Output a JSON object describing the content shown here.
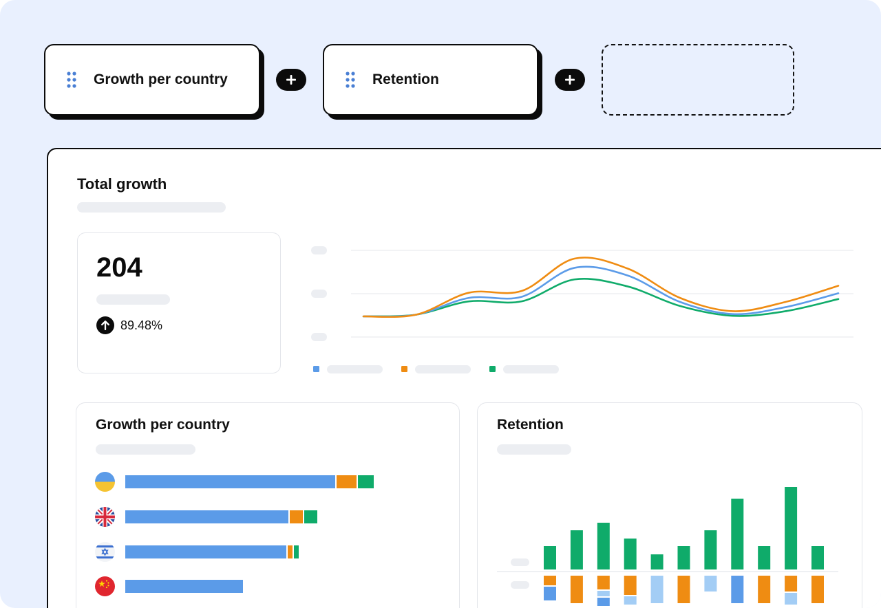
{
  "widgets": {
    "chips": [
      {
        "label": "Growth per country"
      },
      {
        "label": "Retention"
      }
    ]
  },
  "colors": {
    "blue": "#5b9be8",
    "orange": "#ef8c12",
    "green": "#0fab6a",
    "light_blue": "#a3cdf5",
    "dark": "#0b0b0b"
  },
  "dashboard": {
    "title": "Total growth",
    "stat": {
      "value": "204",
      "change": "89.48%",
      "trend_icon": "arrow-up-icon"
    },
    "growth_per_country": {
      "title": "Growth per country",
      "rows": [
        {
          "flag": "ukraine-flag-icon",
          "segments": [
            {
              "color": "blue",
              "value": 305
            },
            {
              "color": "orange",
              "value": 31
            },
            {
              "color": "green",
              "value": 25
            }
          ]
        },
        {
          "flag": "uk-flag-icon",
          "segments": [
            {
              "color": "blue",
              "value": 237
            },
            {
              "color": "orange",
              "value": 21
            },
            {
              "color": "green",
              "value": 21
            }
          ]
        },
        {
          "flag": "israel-flag-icon",
          "segments": [
            {
              "color": "blue",
              "value": 234
            },
            {
              "color": "orange",
              "value": 9
            },
            {
              "color": "green",
              "value": 9
            }
          ]
        },
        {
          "flag": "china-flag-icon",
          "segments": [
            {
              "color": "blue",
              "value": 171
            }
          ]
        }
      ]
    },
    "retention": {
      "title": "Retention"
    }
  },
  "chart_data": [
    {
      "type": "line",
      "title": "",
      "legend": "bottom-left",
      "grid": true,
      "x": [
        0,
        1,
        2,
        3,
        4,
        5,
        6,
        7,
        8,
        9
      ],
      "series": [
        {
          "color": "blue",
          "values": [
            0.0,
            0.3,
            3.2,
            3.4,
            8.4,
            7.1,
            2.5,
            0.4,
            1.6,
            4.0
          ]
        },
        {
          "color": "orange",
          "values": [
            0.0,
            0.3,
            4.1,
            4.4,
            10.0,
            8.3,
            3.2,
            0.9,
            2.5,
            5.3
          ]
        },
        {
          "color": "green",
          "values": [
            0.0,
            0.3,
            2.6,
            2.6,
            6.4,
            5.2,
            1.8,
            0.1,
            0.9,
            3.0
          ]
        }
      ],
      "ylim": [
        0,
        11
      ]
    },
    {
      "type": "bar",
      "title": "",
      "grid": true,
      "categories": [
        "1",
        "2",
        "3",
        "4",
        "5",
        "6",
        "7",
        "8",
        "9",
        "10",
        "11"
      ],
      "series": [
        {
          "color": "green",
          "direction": "up",
          "values": [
            34,
            57,
            68,
            45,
            22,
            34,
            57,
            103,
            34,
            120,
            34
          ]
        }
      ],
      "down_stacks": [
        [
          {
            "color": "orange",
            "value": 14
          },
          {
            "color": "blue",
            "value": 20
          }
        ],
        [
          {
            "color": "orange",
            "value": 40
          }
        ],
        [
          {
            "color": "orange",
            "value": 20
          },
          {
            "color": "light_blue",
            "value": 8
          },
          {
            "color": "blue",
            "value": 12
          }
        ],
        [
          {
            "color": "orange",
            "value": 28
          },
          {
            "color": "light_blue",
            "value": 12
          }
        ],
        [
          {
            "color": "light_blue",
            "value": 40
          }
        ],
        [
          {
            "color": "orange",
            "value": 40
          }
        ],
        [
          {
            "color": "light_blue",
            "value": 23
          }
        ],
        [
          {
            "color": "blue",
            "value": 40
          }
        ],
        [
          {
            "color": "orange",
            "value": 40
          }
        ],
        [
          {
            "color": "orange",
            "value": 23
          },
          {
            "color": "light_blue",
            "value": 17
          }
        ],
        [
          {
            "color": "orange",
            "value": 40
          }
        ]
      ]
    }
  ]
}
